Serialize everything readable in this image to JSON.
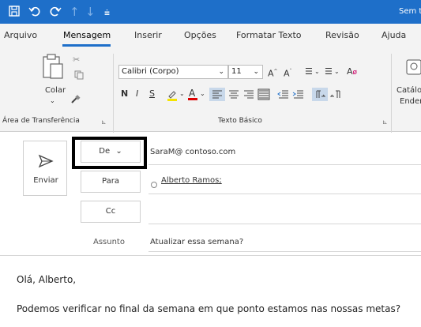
{
  "title": "Sem t",
  "quick_access": {
    "save_icon": "save-icon",
    "undo_icon": "undo-icon",
    "redo_icon": "redo-icon",
    "up_icon": "arrow-up-icon",
    "down_icon": "arrow-down-icon",
    "more_icon": "customize-icon"
  },
  "tabs": [
    {
      "label": "Arquivo"
    },
    {
      "label": "Mensagem"
    },
    {
      "label": "Inserir"
    },
    {
      "label": "Opções"
    },
    {
      "label": "Formatar Texto"
    },
    {
      "label": "Revisão"
    },
    {
      "label": "Ajuda"
    }
  ],
  "ribbon": {
    "clipboard": {
      "paste_label": "Colar",
      "group_label": "Área de Transferência",
      "launcher": "⊾"
    },
    "basic_text": {
      "font_name": "Calibri (Corpo)",
      "font_size": "11",
      "bold": "N",
      "italic": "I",
      "underline": "S",
      "group_label": "Texto Básico",
      "launcher": "⊾"
    },
    "names": {
      "label_line1": "Catálo",
      "label_line2": "Ender"
    }
  },
  "compose": {
    "send_label": "Enviar",
    "from_button": "De",
    "from_value": "SaraM@ contoso.com",
    "to_button": "Para",
    "to_value": "Alberto Ramos;",
    "cc_button": "Cc",
    "subject_label": "Assunto",
    "subject_value": "Atualizar essa semana?"
  },
  "body": {
    "greeting": "Olá, Alberto,",
    "line1": "Podemos verificar no final da semana em que ponto estamos nas nossas metas?"
  },
  "colors": {
    "accent": "#1e6fc9",
    "highlight_border": "#000000"
  }
}
